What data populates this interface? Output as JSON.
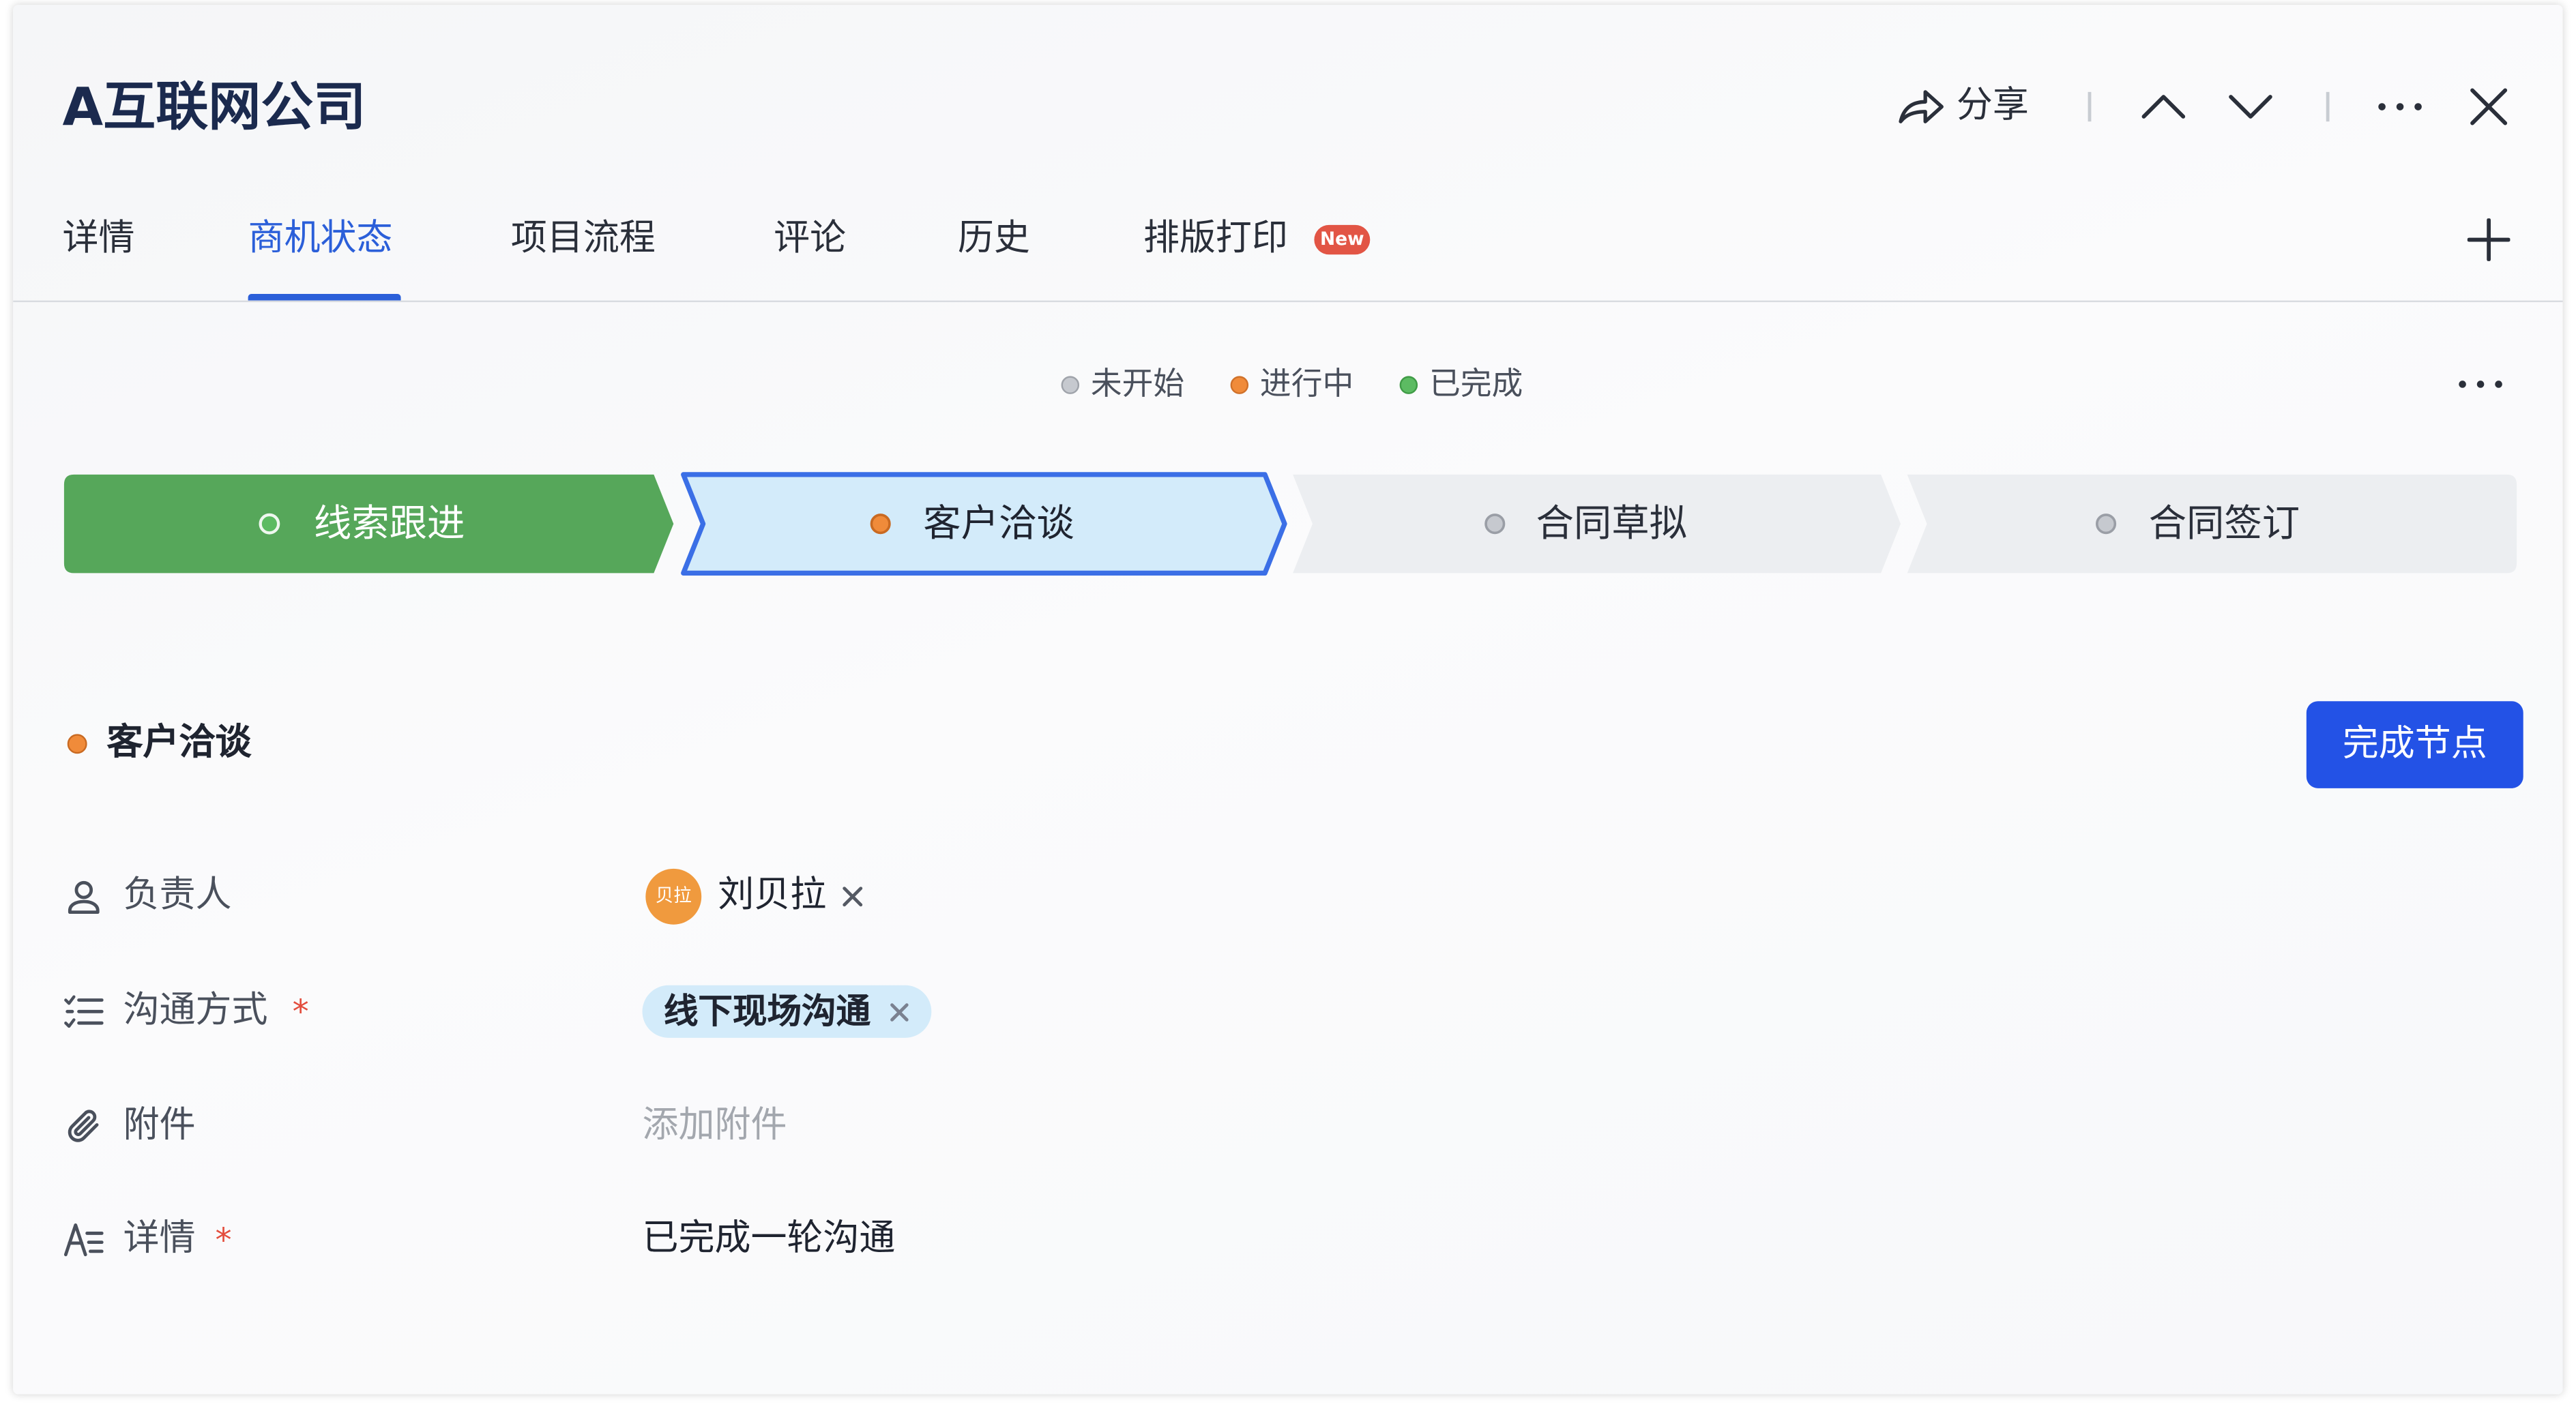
{
  "header": {
    "title": "A互联网公司",
    "share": {
      "label": "分享",
      "icon": "share-icon"
    },
    "icons": [
      "chevron-up-icon",
      "chevron-down-icon",
      "more-icon",
      "close-icon"
    ]
  },
  "tabs": [
    {
      "label": "详情",
      "active": false
    },
    {
      "label": "商机状态",
      "active": true
    },
    {
      "label": "项目流程",
      "active": false
    },
    {
      "label": "评论",
      "active": false
    },
    {
      "label": "历史",
      "active": false
    },
    {
      "label": "排版打印",
      "active": false,
      "badge": "New"
    }
  ],
  "tabs_add_icon": "plus-icon",
  "legend": [
    {
      "label": "未开始",
      "color": "#c6c9cf"
    },
    {
      "label": "进行中",
      "color": "#f08b3a"
    },
    {
      "label": "已完成",
      "color": "#5cbb62"
    }
  ],
  "legend_more_icon": "more-icon",
  "stages": [
    {
      "label": "线索跟进",
      "fill": "#56a75a",
      "dot": "#5cbb62",
      "text_color": "#ffffff",
      "selected": false
    },
    {
      "label": "客户洽谈",
      "fill": "#d3ebfa",
      "dot": "#f08b3a",
      "text_color": "#1f2430",
      "selected": true,
      "border": "#3b6fe6"
    },
    {
      "label": "合同草拟",
      "fill": "#eceef1",
      "dot": "#c6c9cf",
      "text_color": "#2a2f3a",
      "selected": false
    },
    {
      "label": "合同签订",
      "fill": "#eceef1",
      "dot": "#c6c9cf",
      "text_color": "#2a2f3a",
      "selected": false
    }
  ],
  "current_stage": {
    "title": "客户洽谈",
    "dot": "#f08b3a",
    "complete_button": "完成节点"
  },
  "fields": {
    "required_mark": "*",
    "owner": {
      "label": "负责人",
      "icon": "user-icon",
      "avatar_text": "贝拉",
      "avatar_color": "#f09a3e",
      "name": "刘贝拉",
      "remove_icon": "close-icon"
    },
    "contact_method": {
      "label": "沟通方式",
      "icon": "list-icon",
      "required": true,
      "value": "线下现场沟通",
      "tag_color": "#d3ebfa",
      "remove_icon": "close-icon"
    },
    "attachment": {
      "label": "附件",
      "icon": "paperclip-icon",
      "placeholder": "添加附件"
    },
    "details": {
      "label": "详情",
      "icon": "text-format-icon",
      "required": true,
      "value": "已完成一轮沟通"
    }
  },
  "colors": {
    "accent": "#2b5fd9",
    "primary_button": "#2352e6",
    "required": "#e34d3d",
    "badge": "#e25545"
  }
}
